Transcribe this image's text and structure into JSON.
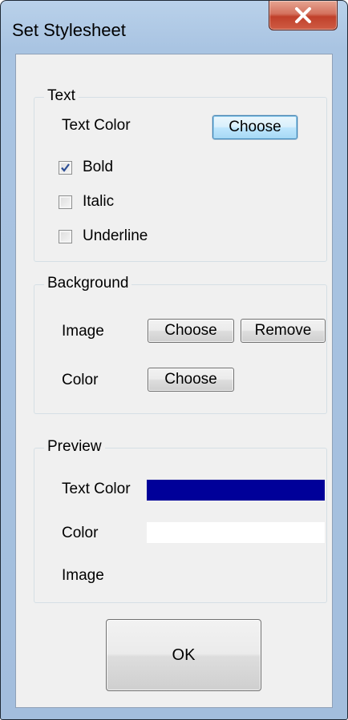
{
  "window": {
    "title": "Set Stylesheet",
    "close_icon": "close-x-icon"
  },
  "text_group": {
    "label": "Text",
    "text_color_label": "Text Color",
    "choose_label": "Choose",
    "options": [
      {
        "label": "Bold",
        "checked": true
      },
      {
        "label": "Italic",
        "checked": false
      },
      {
        "label": "Underline",
        "checked": false
      }
    ]
  },
  "background_group": {
    "label": "Background",
    "image_label": "Image",
    "image_choose_label": "Choose",
    "image_remove_label": "Remove",
    "color_label": "Color",
    "color_choose_label": "Choose"
  },
  "preview_group": {
    "label": "Preview",
    "text_color_label": "Text Color",
    "text_color_value": "#000099",
    "color_label": "Color",
    "color_value": "#ffffff",
    "image_label": "Image"
  },
  "ok_label": "OK"
}
